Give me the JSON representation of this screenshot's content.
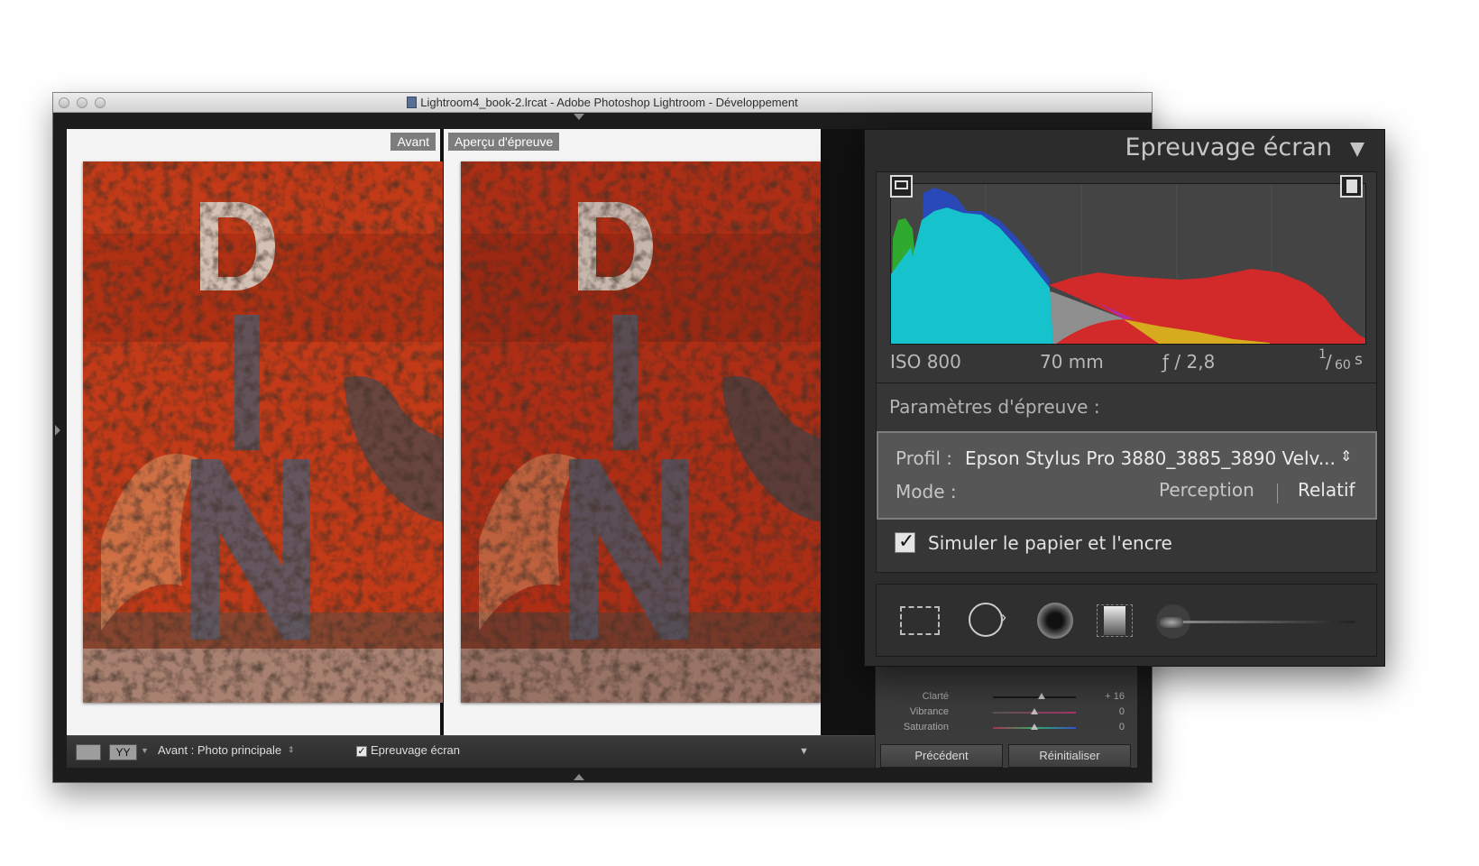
{
  "window": {
    "title": "Lightroom4_book-2.lrcat - Adobe Photoshop Lightroom - Développement"
  },
  "compare": {
    "before_label": "Avant",
    "after_label": "Aperçu d'épreuve"
  },
  "toolbar": {
    "view_mode_label": "YY",
    "before_select": "Avant : Photo principale",
    "proof_checkbox_checked": true,
    "proof_checkbox_label": "Epreuvage écran"
  },
  "right_panel": {
    "sliders": [
      {
        "label": "Clarté",
        "value": "+ 16",
        "level": 0.58
      },
      {
        "label": "Vibrance",
        "value": "0",
        "level": 0.5
      },
      {
        "label": "Saturation",
        "value": "0",
        "level": 0.5
      }
    ],
    "prev_button": "Précédent",
    "reset_button": "Réinitialiser"
  },
  "proof_panel": {
    "title": "Epreuvage écran",
    "exif": {
      "iso": "ISO 800",
      "focal": "70 mm",
      "aperture": "ƒ / 2,8",
      "shutter_num": "1",
      "shutter_den": "60",
      "shutter_unit": "s"
    },
    "section_title": "Paramètres d'épreuve :",
    "profile_label": "Profil :",
    "profile_value": "Epson Stylus Pro 3880_3885_3890 Velv...",
    "mode_label": "Mode :",
    "mode_options": [
      "Perception",
      "Relatif"
    ],
    "mode_selected": "Relatif",
    "simulate_checked": true,
    "simulate_label": "Simuler le papier et l'encre"
  },
  "icons": {
    "window_controls": [
      "close-icon",
      "minimize-icon",
      "zoom-icon"
    ],
    "tools": [
      "crop-overlay-icon",
      "spot-removal-icon",
      "red-eye-icon",
      "graduated-filter-icon",
      "adjustment-brush-icon"
    ],
    "histogram_clipping": [
      "shadow-clipping-icon",
      "highlight-clipping-icon"
    ]
  }
}
